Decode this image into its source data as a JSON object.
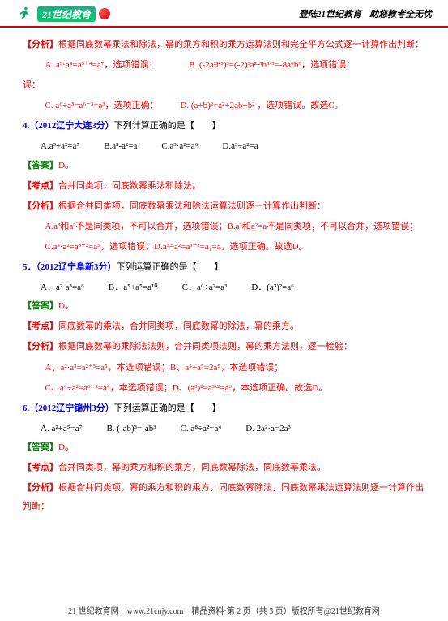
{
  "header": {
    "logo_text": "21世纪教育",
    "right1": "登陆21世纪教育",
    "right2": "助您教考全无忧"
  },
  "block1": {
    "fenxi_label": "【分析】",
    "fenxi_text": "根据同底数幂乘法和除法，幂的乘方和积的乘方运算法则和完全平方公式逐一计算作出判断：",
    "optA": "A. a³·a⁴=a³⁺⁴=a⁷，选项错误：",
    "optB": "B. (-2a²b³)³=(-2)³a²ˣ³b³ˣ³=-8a⁶b⁹，选项错误：",
    "optC": "C. a⁶÷a³=a⁶⁻³=a³，选项正确：",
    "optD": "D. (a+b)²=a²+2ab+b² ，选项错误。故选C。"
  },
  "q4": {
    "num": "4.（2012辽宁大连3分）",
    "stem": "下列计算正确的是【　　】",
    "A": "A.a³+a²=a⁵",
    "B": "B.a³-a²=a",
    "C": "C.a³·a²=a⁶",
    "D": "D.a³÷a²=a",
    "ans_label": "【答案】",
    "ans": "D。",
    "kaodian_label": "【考点】",
    "kaodian": "合并同类项，同底数幂乘法和除法。",
    "fenxi_label": "【分析】",
    "fenxi": "根据合并同类项，同底数幂乘法和除法运算法则逐一计算作出判断：",
    "line1": "A.a³和a²不是同类项，不可以合并，选项错误；B.a³和a²=a不是同类项，不可以合并，选项错误；",
    "line2": "C.a³·a²=a³⁺²=a⁵，选项错误；D.a³÷a²=a³⁻²=a₁=a，选项正确。故选D。"
  },
  "q5": {
    "num": "5．（2012辽宁阜新3分）",
    "stem": "下列运算正确的是【　　】",
    "A": "A．a²·a³=a⁶",
    "B": "B．a⁵+a⁵=a¹⁰",
    "C": "C．a⁶÷a²=a³",
    "D": "D．(a³)²=a⁶",
    "ans_label": "【答案】",
    "ans": "D。",
    "kaodian_label": "【考点】",
    "kaodian": "同底数幂的乘法，合并同类项，同底数幂的除法，幂的乘方。",
    "fenxi_label": "【分析】",
    "fenxi": "根据同底数幂的乘除法法则，合并同类项法则，幂的乘方法则，逐一检验：",
    "line1": "A、a²·a³=a²⁺³=a⁵，本选项错误；B、a⁵+a⁵=2a⁵，本选项错误；",
    "line2": "C、a⁶÷a²=a⁶⁻²=a⁴，本选项错误；D、(a³)²=a³ˣ²=a⁶，本选项正确。故选D。"
  },
  "q6": {
    "num": "6.（2012辽宁锦州3分）",
    "stem": "下列运算正确的是【　　】",
    "A": "A. a²+a⁵=a⁷",
    "B": "B. (-ab)³=-ab³",
    "C": "C. a⁸÷a²=a⁴",
    "D": "D. 2a²·a=2a³",
    "ans_label": "【答案】",
    "ans": "D。",
    "kaodian_label": "【考点】",
    "kaodian": "合并同类项，幂的乘方和积的乘方，同底数幂除法，同底数幂乘法。",
    "fenxi_label": "【分析】",
    "fenxi": "根据合并同类项，幂的乘方和积的乘方，同底数幂除法，同底数幂乘法运算法则逐一计算作出判断："
  },
  "footer": {
    "text": "21 世纪教育网　www.21cnjy.com　精品资料·第 2 页（共 3 页）版权所有@21世纪教育网"
  }
}
